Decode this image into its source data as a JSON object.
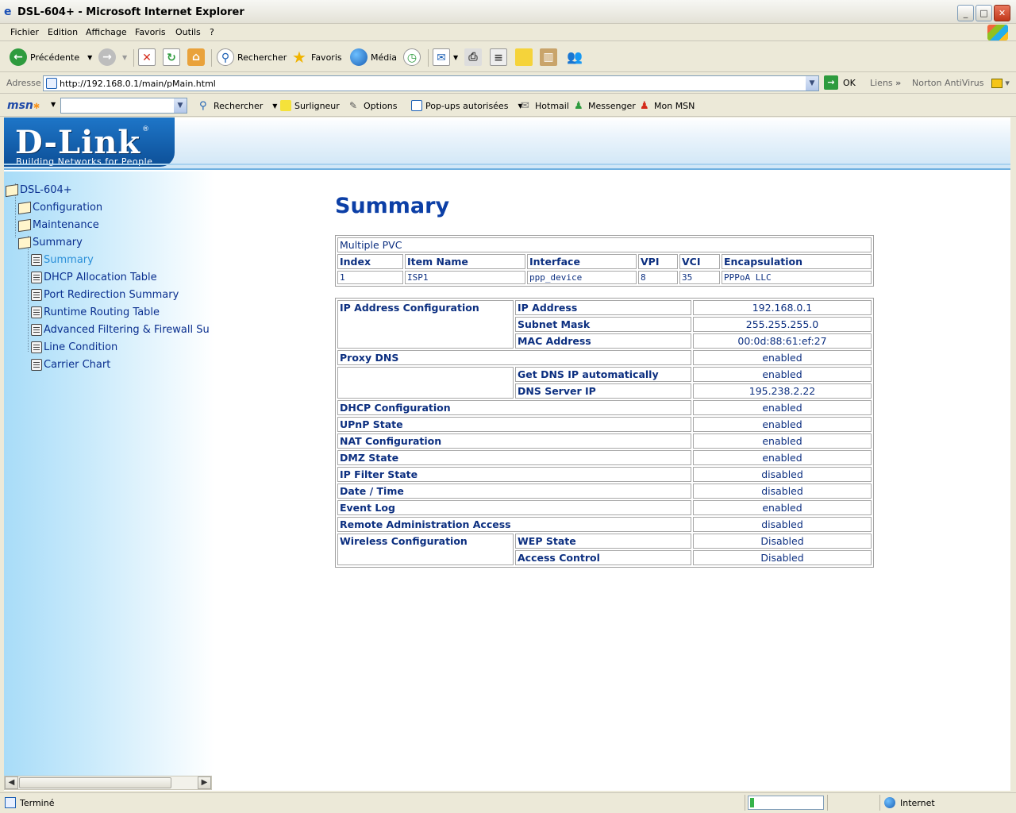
{
  "window": {
    "title": "DSL-604+ - Microsoft Internet Explorer",
    "controls": [
      "minimize",
      "maximize",
      "close"
    ]
  },
  "menu": [
    "Fichier",
    "Edition",
    "Affichage",
    "Favoris",
    "Outils",
    "?"
  ],
  "toolbar": {
    "back": "Précédente",
    "search": "Rechercher",
    "favorites": "Favoris",
    "media": "Média"
  },
  "address": {
    "label": "Adresse",
    "url": "http://192.168.0.1/main/pMain.html",
    "go": "OK",
    "links": "Liens",
    "norton": "Norton AntiVirus"
  },
  "msnbar": {
    "logo": "msn",
    "search": "Rechercher",
    "highlighter": "Surligneur",
    "options": "Options",
    "popups": "Pop-ups autorisées",
    "hotmail": "Hotmail",
    "messenger": "Messenger",
    "mymsn": "Mon MSN"
  },
  "header": {
    "logo": "D-Link",
    "slogan": "Building Networks for People"
  },
  "tree": {
    "root": "DSL-604+",
    "configuration": "Configuration",
    "maintenance": "Maintenance",
    "summary_folder": "Summary",
    "items": [
      {
        "label": "Summary",
        "active": true
      },
      {
        "label": "DHCP Allocation Table"
      },
      {
        "label": "Port Redirection Summary"
      },
      {
        "label": "Runtime Routing Table"
      },
      {
        "label": "Advanced Filtering & Firewall Su"
      },
      {
        "label": "Line Condition"
      },
      {
        "label": "Carrier Chart"
      }
    ]
  },
  "main": {
    "title": "Summary",
    "pvc": {
      "caption": "Multiple PVC",
      "headers": [
        "Index",
        "Item Name",
        "Interface",
        "VPI",
        "VCI",
        "Encapsulation"
      ],
      "rows": [
        [
          "1",
          "ISP1",
          "ppp_device",
          "8",
          "35",
          "PPPoA LLC"
        ]
      ]
    },
    "summary": {
      "ip_config": "IP Address Configuration",
      "ip_address_label": "IP Address",
      "ip_address": "192.168.0.1",
      "subnet_label": "Subnet Mask",
      "subnet": "255.255.255.0",
      "mac_label": "MAC Address",
      "mac": "00:0d:88:61:ef:27",
      "proxy_dns": "Proxy DNS",
      "proxy_dns_value": "enabled",
      "get_dns_label": "Get DNS IP automatically",
      "get_dns_value": "enabled",
      "dns_server_label": "DNS Server IP",
      "dns_server_value": "195.238.2.22",
      "rows": [
        {
          "label": "DHCP Configuration",
          "value": "enabled"
        },
        {
          "label": "UPnP State",
          "value": "enabled"
        },
        {
          "label": "NAT Configuration",
          "value": "enabled"
        },
        {
          "label": "DMZ State",
          "value": "enabled"
        },
        {
          "label": "IP Filter State",
          "value": "disabled"
        },
        {
          "label": "Date / Time",
          "value": "disabled"
        },
        {
          "label": "Event Log",
          "value": "enabled"
        },
        {
          "label": "Remote Administration Access",
          "value": "disabled"
        }
      ],
      "wireless": "Wireless Configuration",
      "wep_label": "WEP State",
      "wep_value": "Disabled",
      "access_label": "Access Control",
      "access_value": "Disabled"
    }
  },
  "status": {
    "text": "Terminé",
    "progress": 0.05,
    "zone": "Internet"
  }
}
